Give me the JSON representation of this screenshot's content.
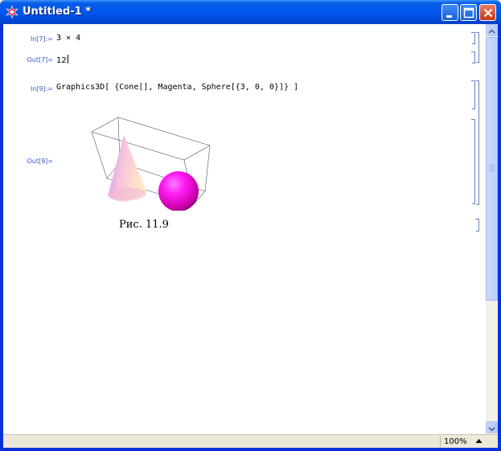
{
  "window": {
    "title": "Untitled-1 *"
  },
  "cells": [
    {
      "in_label": "In[7]:=",
      "input": "3 × 4",
      "out_label": "Out[7]=",
      "output": "12"
    },
    {
      "in_label": "In[9]:=",
      "input": "Graphics3D[ {Cone[], Magenta, Sphere[{3, 0, 0}]} ]",
      "out_label": "Out[9]="
    }
  ],
  "figure": {
    "caption": "Рис. 11.9",
    "objects": [
      "cone",
      "sphere"
    ],
    "sphere_color": "#ff00ff"
  },
  "status": {
    "zoom": "100%"
  },
  "colors": {
    "titlebar": "#0058ee",
    "label": "#3a57c4",
    "bracket": "#6a7fbf"
  }
}
